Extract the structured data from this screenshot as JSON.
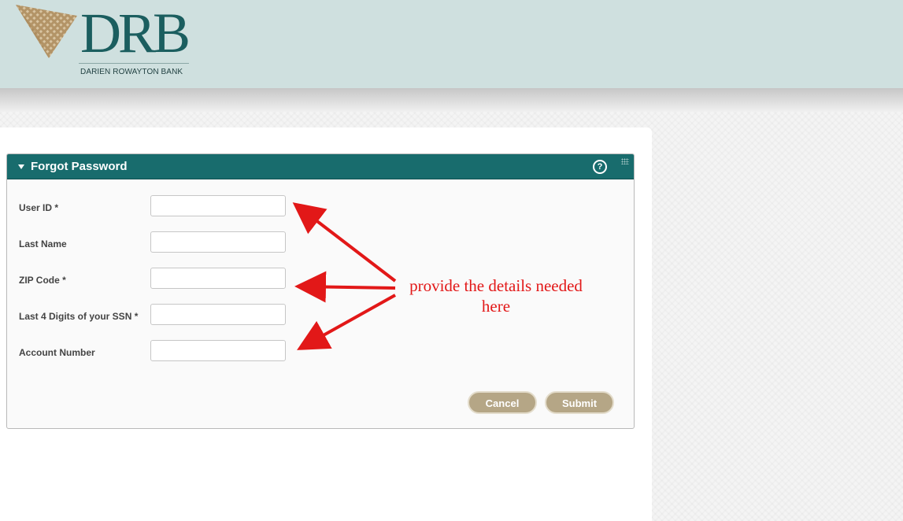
{
  "brand": {
    "logo_text": "DRB",
    "bank_name": "DARIEN ROWAYTON BANK",
    "colors": {
      "primary": "#186c6d",
      "accent": "#b5a686",
      "header_bg": "#cfe0df"
    }
  },
  "panel": {
    "title": "Forgot Password",
    "help_icon": "?",
    "fields": [
      {
        "label": "User ID *",
        "value": ""
      },
      {
        "label": "Last Name",
        "value": ""
      },
      {
        "label": "ZIP Code *",
        "value": ""
      },
      {
        "label": "Last 4 Digits of your SSN *",
        "value": ""
      },
      {
        "label": "Account Number",
        "value": ""
      }
    ],
    "buttons": {
      "cancel": "Cancel",
      "submit": "Submit"
    }
  },
  "annotation": {
    "line1": "provide the details needed",
    "line2": "here",
    "color": "#e21818"
  }
}
